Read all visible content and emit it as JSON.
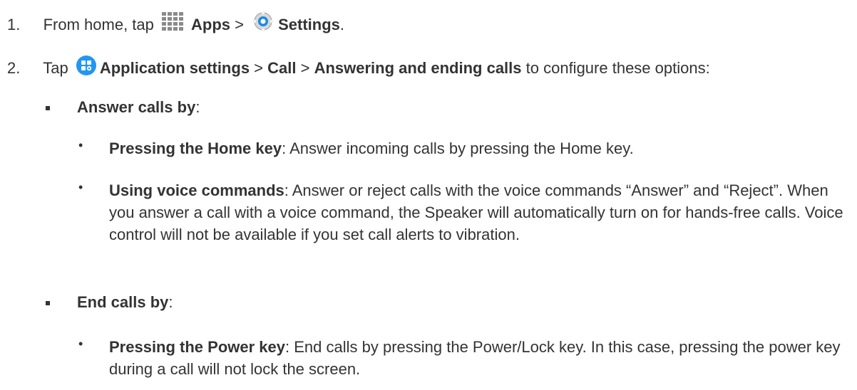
{
  "step1": {
    "num": "1.",
    "pre": "From home, tap",
    "apps": "Apps",
    "sep": " > ",
    "settings": "Settings",
    "end": ".",
    "apps_icon": "apps-grid-icon",
    "settings_icon": "settings-gear-icon"
  },
  "step2": {
    "num": "2.",
    "pre": "Tap",
    "app_settings": "Application settings",
    "sep1": " > ",
    "call": "Call",
    "sep2": " > ",
    "answering": "Answering and ending calls",
    "post": " to configure these options:",
    "app_icon": "application-settings-icon"
  },
  "answer": {
    "title": "Answer calls by",
    "colon": ":",
    "home_title": "Pressing the Home key",
    "home_text": ": Answer incoming calls by pressing the Home key.",
    "voice_title": "Using voice commands",
    "voice_text": ": Answer or reject calls with the voice commands “Answer” and “Reject”. When you answer a call with a voice command, the Speaker will automatically turn on for hands-free calls. Voice control will not be available if you set call alerts to vibration."
  },
  "end": {
    "title": "End calls by",
    "colon": ":",
    "power_title": "Pressing the Power key",
    "power_text": ": End calls by pressing the Power/Lock key. In this case, pressing the power key during a call will not lock the screen."
  },
  "bullet_dot": "•"
}
